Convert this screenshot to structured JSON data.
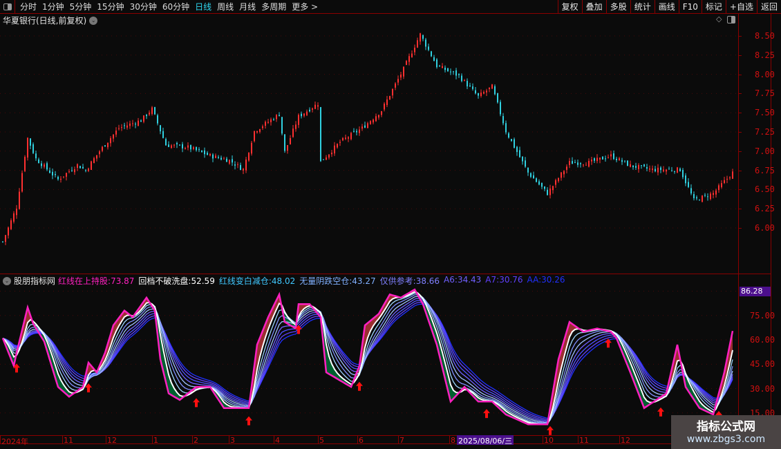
{
  "toolbar": {
    "periods": [
      "分时",
      "1分钟",
      "5分钟",
      "15分钟",
      "30分钟",
      "60分钟",
      "日线",
      "周线",
      "月线",
      "多周期",
      "更多 >"
    ],
    "active": "日线",
    "right_buttons": [
      "复权",
      "叠加",
      "多股",
      "统计",
      "画线",
      "F10",
      "标记",
      "+自选",
      "返回"
    ]
  },
  "chart": {
    "title": "华夏银行(日线,前复权)"
  },
  "price_axis": [
    "8.50",
    "8.25",
    "8.00",
    "7.75",
    "7.50",
    "7.25",
    "7.00",
    "6.75",
    "6.50",
    "6.25",
    "6.00"
  ],
  "indicator": {
    "name": "股朋指标网",
    "items": [
      {
        "label": "红线在上持股:",
        "value": "73.87",
        "color": "#ff20c0"
      },
      {
        "label": "回档不破洗盘:",
        "value": "52.59",
        "color": "#ffffff"
      },
      {
        "label": "红线变白减仓:",
        "value": "48.02",
        "color": "#40c8ff"
      },
      {
        "label": "无量阴跌空仓:",
        "value": "43.27",
        "color": "#80b0ff"
      },
      {
        "label": "仅供参考:",
        "value": "38.66",
        "color": "#8080ff"
      },
      {
        "label": "A6:",
        "value": "34.43",
        "color": "#7060ff"
      },
      {
        "label": "A7:",
        "value": "30.76",
        "color": "#6040ff"
      },
      {
        "label": "AA:",
        "value": "30.26",
        "color": "#2030ff"
      }
    ],
    "axis": [
      "75.00",
      "60.00",
      "45.00",
      "30.00",
      "15.00"
    ],
    "current": "86.28"
  },
  "dates": [
    "2024年",
    "11",
    "12",
    "1",
    "2",
    "3",
    "4",
    "5",
    "6",
    "7",
    "8",
    "10",
    "11",
    "12"
  ],
  "date_highlight": "2025/08/06/三",
  "watermark": {
    "title": "指标公式网",
    "url": "www.zbgs3.com"
  },
  "colors": {
    "up": "#ff3030",
    "down": "#30d0e0",
    "frame": "#8b0000"
  },
  "chart_data": {
    "type": "candlestick",
    "price_keypoints": [
      [
        0,
        5.82
      ],
      [
        5,
        6.27
      ],
      [
        9,
        7.17
      ],
      [
        12,
        6.9
      ],
      [
        20,
        6.63
      ],
      [
        27,
        6.82
      ],
      [
        30,
        6.75
      ],
      [
        35,
        7.0
      ],
      [
        42,
        7.3
      ],
      [
        50,
        7.4
      ],
      [
        54,
        7.55
      ],
      [
        59,
        7.08
      ],
      [
        67,
        7.05
      ],
      [
        75,
        6.94
      ],
      [
        82,
        6.88
      ],
      [
        87,
        6.76
      ],
      [
        91,
        7.26
      ],
      [
        100,
        7.48
      ],
      [
        102,
        6.99
      ],
      [
        107,
        7.45
      ],
      [
        114,
        7.62
      ],
      [
        115,
        6.86
      ],
      [
        122,
        7.12
      ],
      [
        130,
        7.3
      ],
      [
        137,
        7.53
      ],
      [
        145,
        8.07
      ],
      [
        151,
        8.52
      ],
      [
        157,
        8.11
      ],
      [
        165,
        7.98
      ],
      [
        172,
        7.71
      ],
      [
        177,
        7.84
      ],
      [
        182,
        7.26
      ],
      [
        190,
        6.72
      ],
      [
        197,
        6.45
      ],
      [
        205,
        6.85
      ],
      [
        212,
        6.85
      ],
      [
        220,
        6.94
      ],
      [
        227,
        6.81
      ],
      [
        235,
        6.76
      ],
      [
        245,
        6.76
      ],
      [
        250,
        6.36
      ],
      [
        257,
        6.45
      ],
      [
        264,
        6.72
      ]
    ],
    "indicator_keypoints": [
      [
        0,
        61
      ],
      [
        4,
        44
      ],
      [
        5,
        52
      ],
      [
        9,
        80
      ],
      [
        11,
        70
      ],
      [
        15,
        59
      ],
      [
        20,
        31
      ],
      [
        24,
        25
      ],
      [
        29,
        31
      ],
      [
        31,
        46
      ],
      [
        34,
        40
      ],
      [
        37,
        52
      ],
      [
        40,
        69
      ],
      [
        44,
        78
      ],
      [
        47,
        74
      ],
      [
        52,
        86
      ],
      [
        55,
        78
      ],
      [
        57,
        48
      ],
      [
        60,
        27
      ],
      [
        64,
        23
      ],
      [
        70,
        31
      ],
      [
        75,
        31
      ],
      [
        80,
        18
      ],
      [
        85,
        18
      ],
      [
        89,
        18
      ],
      [
        92,
        57
      ],
      [
        96,
        74
      ],
      [
        100,
        88
      ],
      [
        102,
        71
      ],
      [
        106,
        67
      ],
      [
        107,
        82
      ],
      [
        111,
        82
      ],
      [
        115,
        74
      ],
      [
        117,
        40
      ],
      [
        122,
        35
      ],
      [
        126,
        31
      ],
      [
        129,
        44
      ],
      [
        131,
        69
      ],
      [
        136,
        76
      ],
      [
        140,
        88
      ],
      [
        144,
        86
      ],
      [
        149,
        91
      ],
      [
        152,
        82
      ],
      [
        157,
        57
      ],
      [
        162,
        22
      ],
      [
        167,
        31
      ],
      [
        172,
        22
      ],
      [
        177,
        22
      ],
      [
        182,
        14
      ],
      [
        190,
        8
      ],
      [
        197,
        8
      ],
      [
        201,
        48
      ],
      [
        205,
        71
      ],
      [
        210,
        65
      ],
      [
        215,
        67
      ],
      [
        220,
        65
      ],
      [
        222,
        61
      ],
      [
        227,
        40
      ],
      [
        232,
        18
      ],
      [
        240,
        27
      ],
      [
        244,
        57
      ],
      [
        247,
        31
      ],
      [
        252,
        18
      ],
      [
        257,
        14
      ],
      [
        261,
        40
      ],
      [
        265,
        74
      ]
    ],
    "buy_arrow_days": [
      5,
      31,
      70,
      89,
      107,
      129,
      175,
      198,
      219,
      238,
      259
    ],
    "ylim_price": [
      5.75,
      8.6
    ],
    "ylim_indicator": [
      0,
      86.28
    ]
  }
}
